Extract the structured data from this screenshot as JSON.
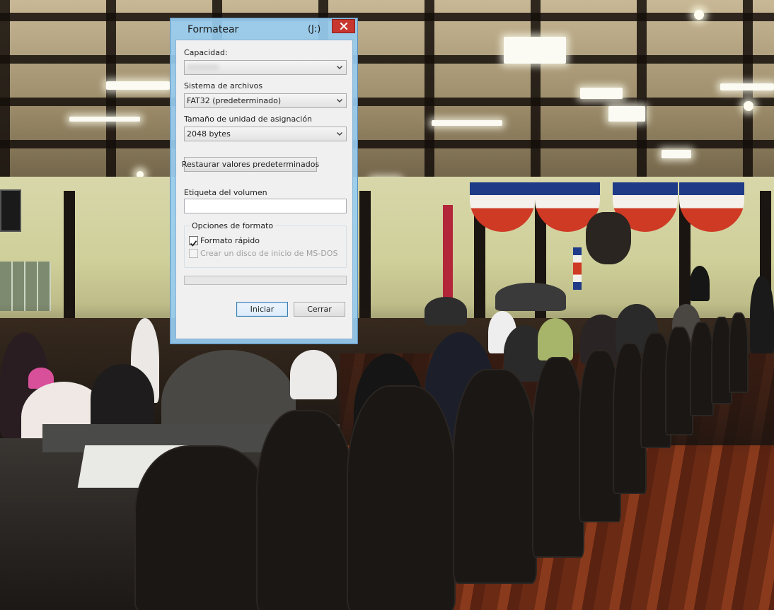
{
  "background": {
    "description_icon": "photo-background"
  },
  "dialog": {
    "title": "Formatear",
    "drive": "(J:)",
    "close_icon": "close-icon",
    "accent_color": "#98cdf0",
    "close_color": "#c7372f",
    "capacity": {
      "label": "Capacidad:",
      "value": ""
    },
    "filesystem": {
      "label": "Sistema de archivos",
      "value": "FAT32 (predeterminado)"
    },
    "allocation": {
      "label": "Tamaño de unidad de asignación",
      "value": "2048 bytes"
    },
    "restore_button": "Restaurar valores predeterminados",
    "volume_label": {
      "label": "Etiqueta del volumen",
      "value": ""
    },
    "format_options": {
      "title": "Opciones de formato",
      "quick_format": {
        "label": "Formato rápido",
        "checked": true
      },
      "msdos_disk": {
        "label": "Crear un disco de inicio de MS-DOS",
        "checked": false,
        "disabled": true
      }
    },
    "progress": 0,
    "start_button": "Iniciar",
    "close_button": "Cerrar"
  }
}
